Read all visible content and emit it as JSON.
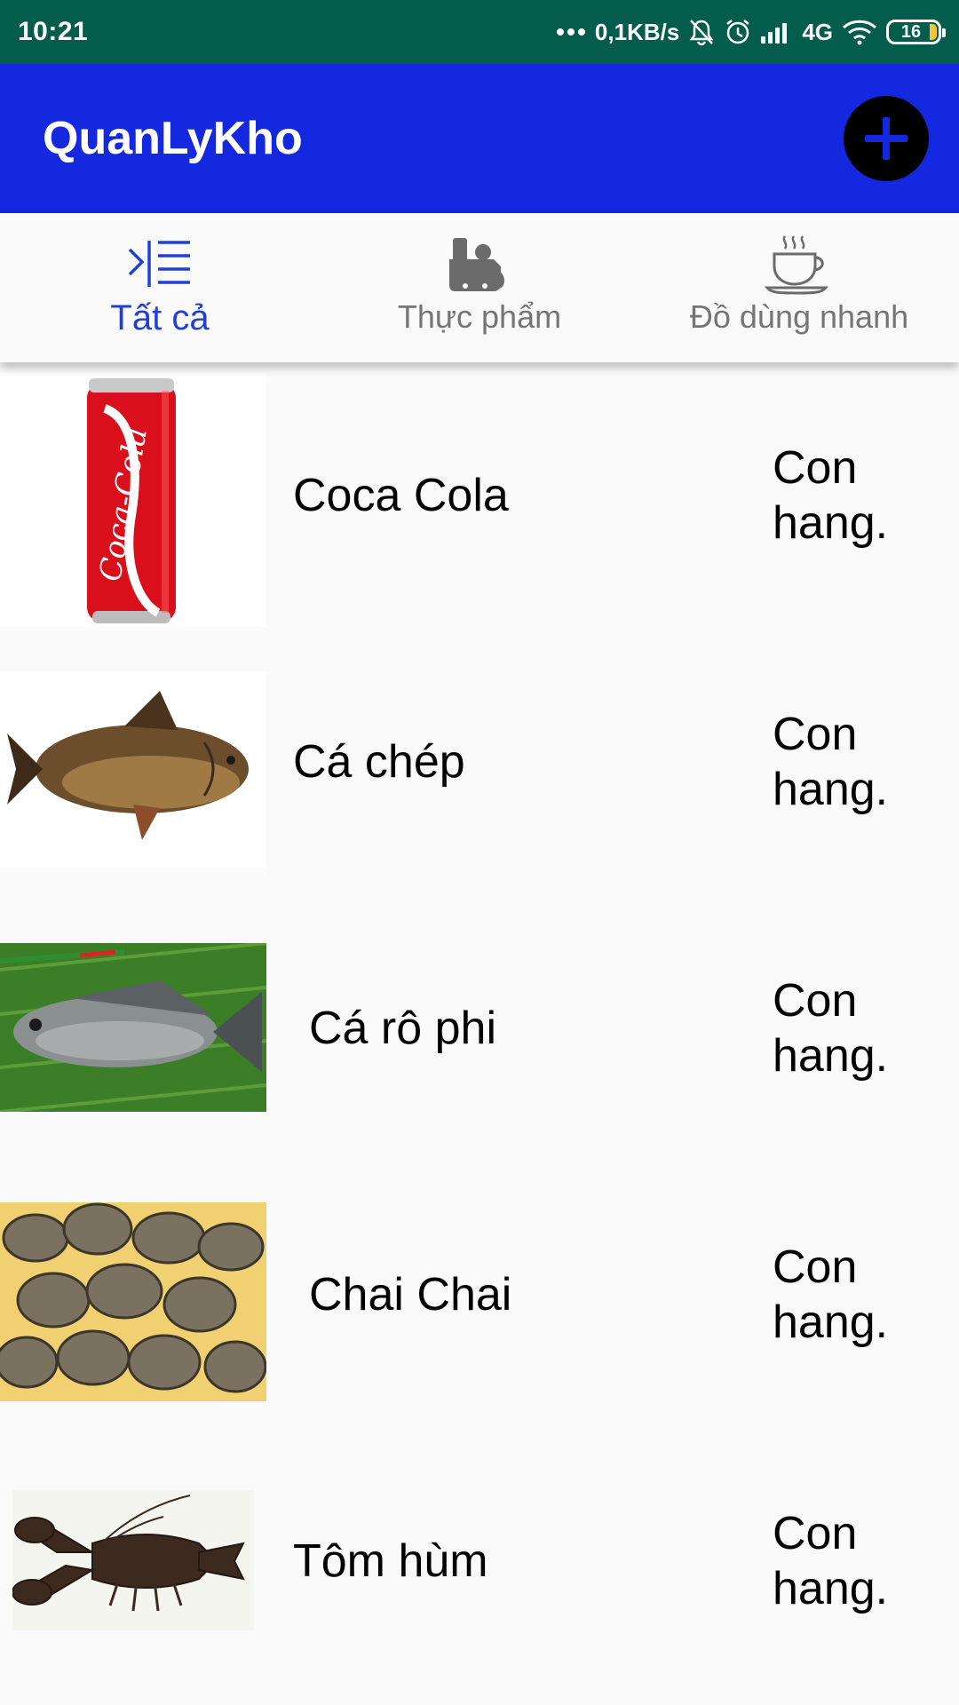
{
  "status_bar": {
    "time": "10:21",
    "network_speed": "0,1KB/s",
    "network_type": "4G",
    "battery_level": "16",
    "icons": [
      "more-dots-icon",
      "mute-bell-icon",
      "alarm-icon",
      "signal-icon",
      "wifi-icon",
      "battery-icon"
    ]
  },
  "app_bar": {
    "title": "QuanLyKho",
    "add_icon": "plus-icon"
  },
  "tabs": [
    {
      "label": "Tất cả",
      "icon": "list-indent-icon",
      "active": true
    },
    {
      "label": "Thực phẩm",
      "icon": "food-machine-icon",
      "active": false
    },
    {
      "label": "Đồ dùng nhanh",
      "icon": "coffee-cup-icon",
      "active": false
    }
  ],
  "products": [
    {
      "name": "Coca Cola",
      "status": "Con hang.",
      "image": "coca-cola-can"
    },
    {
      "name": "Cá chép",
      "status": "Con hang.",
      "image": "carp-fish"
    },
    {
      "name": "Cá rô phi",
      "status": "Con hang.",
      "image": "tilapia-fish"
    },
    {
      "name": "Chai Chai",
      "status": "Con hang.",
      "image": "clams"
    },
    {
      "name": "Tôm hùm",
      "status": "Con hang.",
      "image": "lobster"
    }
  ],
  "colors": {
    "status_bar": "#035c4c",
    "app_bar": "#1428e0",
    "active_tab": "#1f3fd8",
    "inactive_tab": "#757575",
    "background": "#fafafa"
  }
}
